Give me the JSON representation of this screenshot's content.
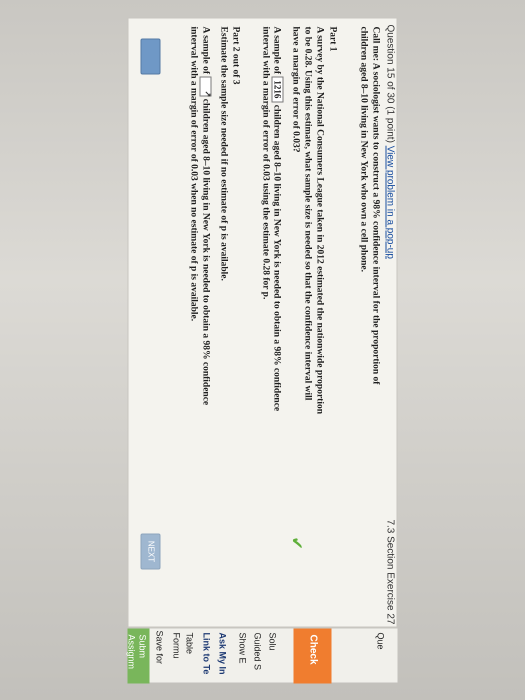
{
  "header": {
    "question_number": "Question 15 of 30 (1 point)",
    "popup_link": "View problem in a pop-up",
    "section": "7.3 Section Exercise 27"
  },
  "problem": {
    "intro_line1": "Call me: A sociologist wants to construct a 98% confidence interval for the proportion of",
    "intro_line2": "children aged 8–10 living in New York who own a cell phone.",
    "part1": {
      "title": "Part 1",
      "line1": "A survey by the National Consumers League taken in 2012 estimated the nationwide proportion",
      "line2": "to be 0.28. Using this estimate, what sample size is needed so that the confidence interval will",
      "line3": "have a margin of error of 0.03?",
      "answer_prefix": "A sample of",
      "answer_value": "1216",
      "answer_suffix_line1": "children aged 8–10 living in New York is needed to obtain a 98% confidence",
      "answer_suffix_line2": "interval with a margin of error of 0.03 using the estimate 0.28 for p."
    },
    "part2": {
      "title": "Part 2 out of 3",
      "line1": "Estimate the sample size needed if no estimate of p is available.",
      "answer_prefix": "A sample of",
      "answer_value": "",
      "answer_suffix_line1": "children aged 8–10 living in New York is needed to obtain a 98% confidence",
      "answer_suffix_line2": "interval with a margin of error of 0.03 when no estimate of p is available."
    }
  },
  "bottom_buttons": {
    "right_label": "NEXT"
  },
  "sidebar": {
    "top_label": "Que",
    "check_label": "Check",
    "solution": "Solu",
    "guided": "Guided S",
    "show": "Show E",
    "ask": "Ask My In",
    "link": "Link to Te",
    "table": "Table",
    "formula": "Formu",
    "save": "Save for",
    "submit_line1": "Subm",
    "submit_line2": "Assignm"
  },
  "colors": {
    "check_button": "#f07d2f",
    "submit_button": "#79b65b",
    "link": "#1a4fa0",
    "checkmark": "#5faf3a"
  }
}
